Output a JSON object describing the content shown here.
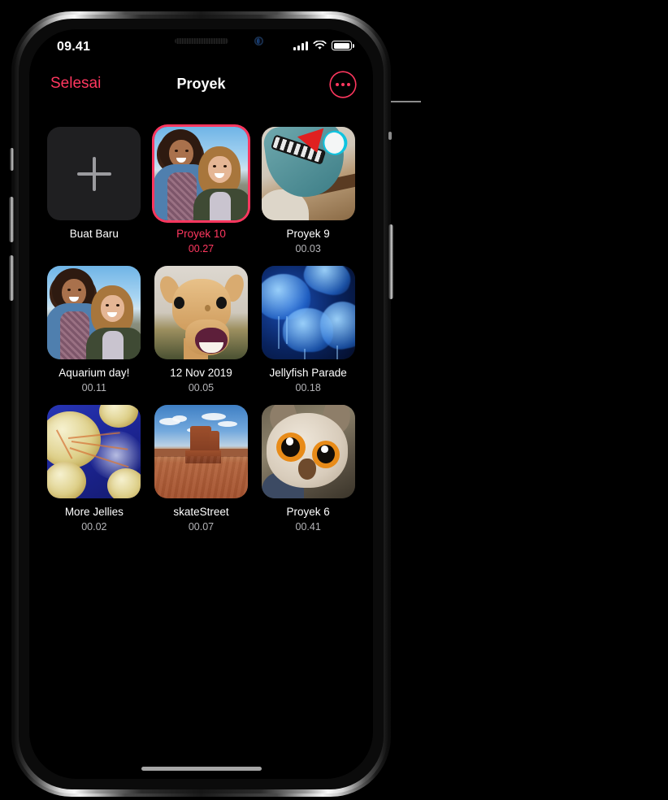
{
  "device": {
    "status_bar": {
      "time": "09.41",
      "cellular_icon": "signal-bars-icon",
      "wifi_icon": "wifi-icon",
      "battery_icon": "battery-full-icon"
    },
    "home_indicator": "home-indicator"
  },
  "navbar": {
    "left_button": "Selesai",
    "title": "Proyek",
    "more_button_icon": "ellipsis-circle-icon"
  },
  "theme": {
    "accent": "#ff375f",
    "background": "#000000",
    "tile_background": "#1f1f21",
    "primary_text": "#ffffff",
    "secondary_text": "#b5b5b8"
  },
  "grid": {
    "new_project": {
      "label": "Buat Baru",
      "icon": "plus-icon"
    },
    "items": [
      {
        "title": "Proyek 10",
        "duration": "00.27",
        "art": "girls",
        "selected": true
      },
      {
        "title": "Proyek 9",
        "duration": "00.03",
        "art": "robot",
        "selected": false
      },
      {
        "title": "Aquarium day!",
        "duration": "00.11",
        "art": "girls",
        "selected": false
      },
      {
        "title": "12 Nov 2019",
        "duration": "00.05",
        "art": "camel",
        "selected": false
      },
      {
        "title": "Jellyfish Parade",
        "duration": "00.18",
        "art": "jelly",
        "selected": false
      },
      {
        "title": "More Jellies",
        "duration": "00.02",
        "art": "jelly2",
        "selected": false
      },
      {
        "title": "skateStreet",
        "duration": "00.07",
        "art": "desert",
        "selected": false
      },
      {
        "title": "Proyek 6",
        "duration": "00.41",
        "art": "owl",
        "selected": false
      }
    ]
  },
  "callout": {
    "target": "Proyek 10",
    "line_color": "#8c8c8c"
  }
}
